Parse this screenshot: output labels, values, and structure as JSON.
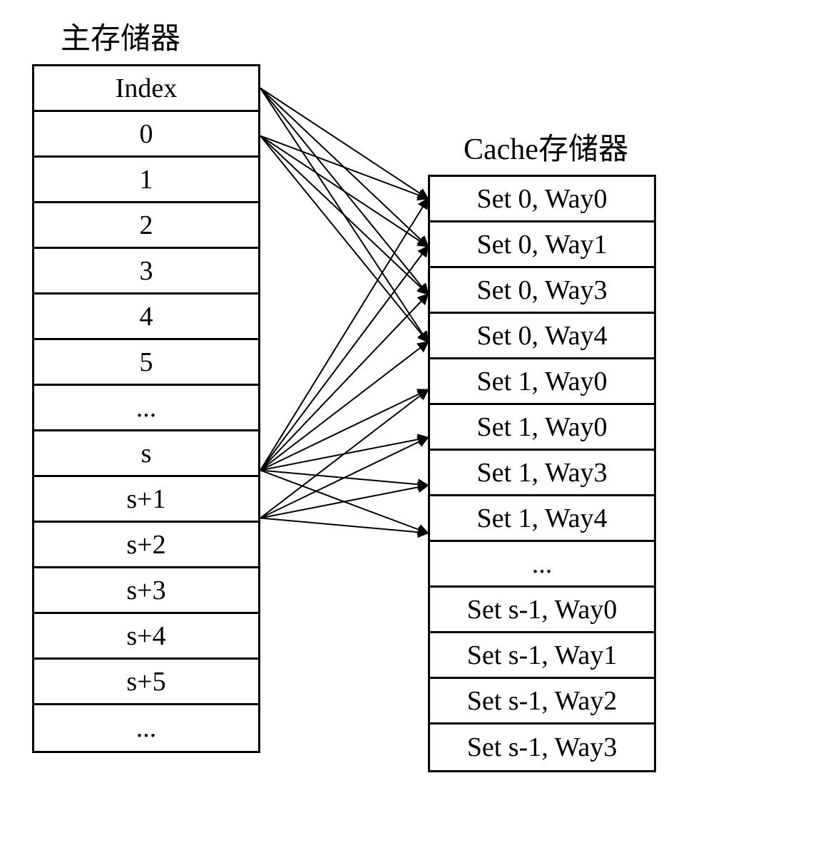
{
  "main_memory": {
    "title": "主存储器",
    "rows": [
      "Index",
      "0",
      "1",
      "2",
      "3",
      "4",
      "5",
      "...",
      "s",
      "s+1",
      "s+2",
      "s+3",
      "s+4",
      "s+5",
      "..."
    ]
  },
  "cache": {
    "title": "Cache存储器",
    "rows": [
      "Set 0, Way0",
      "Set 0, Way1",
      "Set 0, Way3",
      "Set 0, Way4",
      "Set 1, Way0",
      "Set 1, Way0",
      "Set 1, Way3",
      "Set 1, Way4",
      "...",
      "Set s-1, Way0",
      "Set s-1, Way1",
      "Set s-1, Way2",
      "Set s-1, Way3"
    ]
  },
  "mapping": {
    "description": "Set-associative cache mapping: main memory block maps to cache set by index mod s; each set has 4 ways; arrows show Index and block 0 map to Set 0, block s and s+1 also map to Set 0/Set 1 via 4-way fan-out",
    "arrows": [
      {
        "from_row": 0,
        "to_rows": [
          0,
          1,
          2,
          3
        ]
      },
      {
        "from_row": 1,
        "to_rows": [
          0,
          1,
          2,
          3
        ]
      },
      {
        "from_row": 8,
        "to_rows": [
          0,
          1,
          2,
          3
        ]
      },
      {
        "from_row": 8,
        "to_rows": [
          4,
          5,
          6,
          7
        ]
      },
      {
        "from_row": 9,
        "to_rows": [
          4,
          5,
          6,
          7
        ]
      }
    ]
  }
}
